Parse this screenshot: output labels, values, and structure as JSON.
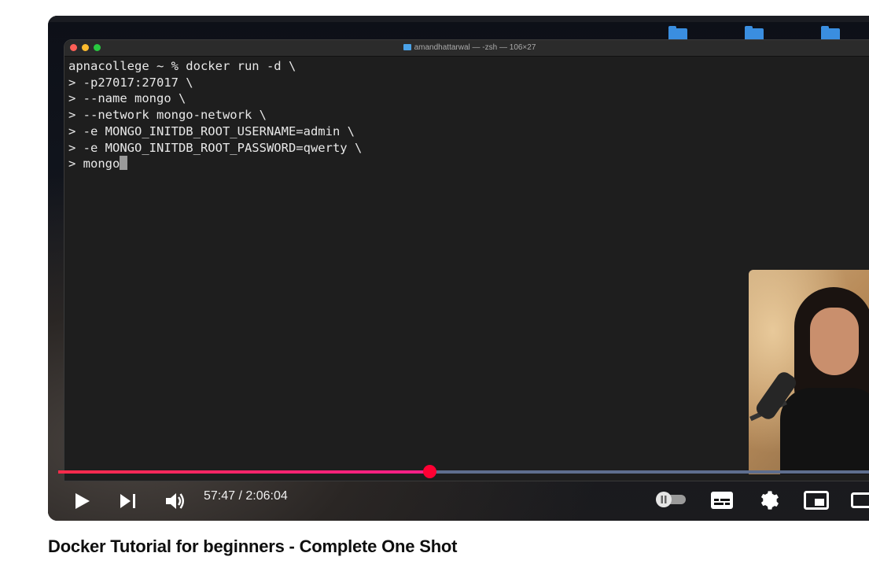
{
  "terminal": {
    "window_title": "amandhattarwal — -zsh — 106×27",
    "lines": [
      "apnacollege ~ % docker run -d \\",
      "> -p27017:27017 \\",
      "> --name mongo \\",
      "> --network mongo-network \\",
      "> -e MONGO_INITDB_ROOT_USERNAME=admin \\",
      "> -e MONGO_INITDB_ROOT_PASSWORD=qwerty \\",
      "> mongo"
    ]
  },
  "player": {
    "current_time": "57:47",
    "separator": " / ",
    "duration": "2:06:04",
    "progress_fraction": 0.4582,
    "colors": {
      "played": "#ff0033",
      "track": "#1e4f9a"
    },
    "icons": [
      "play-icon",
      "next-icon",
      "volume-icon",
      "autoplay-toggle-icon",
      "subtitles-icon",
      "settings-icon",
      "miniplayer-icon",
      "theater-icon"
    ]
  },
  "video": {
    "title": "Docker Tutorial for beginners - Complete One Shot"
  }
}
